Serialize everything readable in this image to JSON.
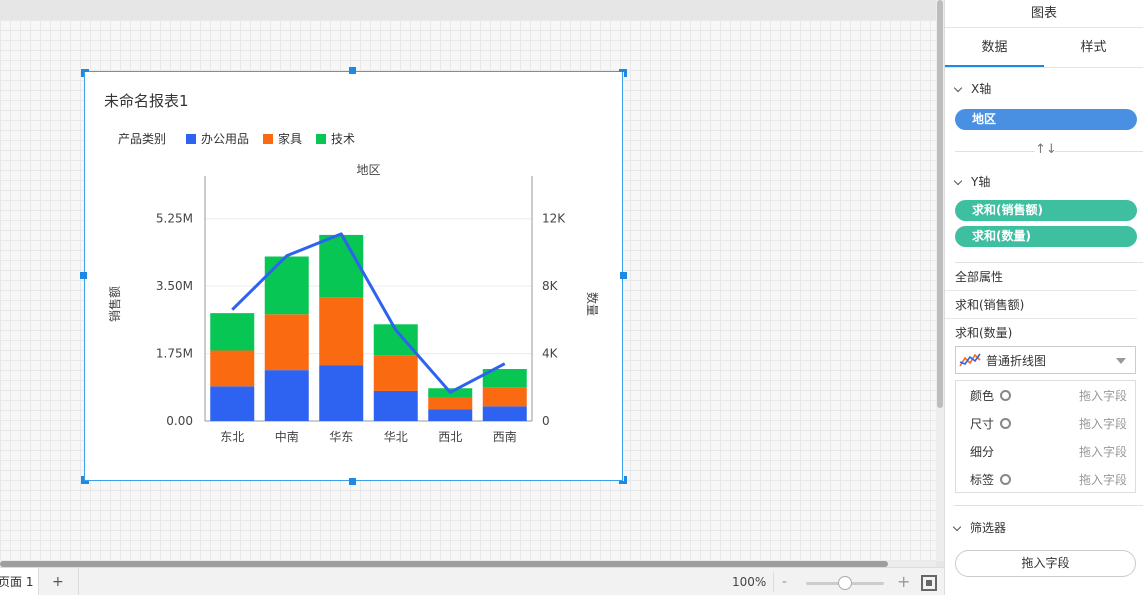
{
  "widget": {
    "title": "未命名报表1"
  },
  "legend": {
    "title": "产品类别",
    "items": [
      {
        "label": "办公用品",
        "color": "#2d63f0"
      },
      {
        "label": "家具",
        "color": "#fa6b11"
      },
      {
        "label": "技术",
        "color": "#08c654"
      }
    ]
  },
  "chart_data": {
    "type": "bar",
    "stacked": true,
    "title": "",
    "xlabel": "地区",
    "ylabel": "销售额",
    "y2label": "数量",
    "categories": [
      "东北",
      "中南",
      "华东",
      "华北",
      "西北",
      "西南"
    ],
    "series": [
      {
        "name": "办公用品",
        "type": "bar",
        "values": [
          0.9,
          1.32,
          1.45,
          0.78,
          0.3,
          0.38
        ]
      },
      {
        "name": "家具",
        "type": "bar",
        "values": [
          0.93,
          1.45,
          1.75,
          0.93,
          0.3,
          0.5
        ]
      },
      {
        "name": "技术",
        "type": "bar",
        "values": [
          0.97,
          1.5,
          1.63,
          0.8,
          0.25,
          0.47
        ]
      }
    ],
    "line": {
      "name": "数量",
      "type": "line",
      "axis": "right",
      "values": [
        6600,
        9800,
        11100,
        5400,
        1700,
        3400
      ],
      "color": "#2d63f0"
    },
    "yticks": [
      "0.00",
      "1.75M",
      "3.50M",
      "5.25M"
    ],
    "ytick_values": [
      0,
      1.75,
      3.5,
      5.25
    ],
    "y2ticks": [
      "0",
      "4K",
      "8K",
      "12K"
    ],
    "y2tick_values": [
      0,
      4000,
      8000,
      12000
    ],
    "ylim": [
      0,
      6.1
    ],
    "y2lim": [
      0,
      13940
    ],
    "grid": true,
    "legend_position": "top-left"
  },
  "panel": {
    "title": "图表",
    "tabs": [
      "数据",
      "样式"
    ],
    "x_axis_label": "X轴",
    "x_field": "地区",
    "swap_icon": "↑↓",
    "y_axis_label": "Y轴",
    "y_fields": [
      "求和(销售额)",
      "求和(数量)"
    ],
    "props": [
      "全部属性",
      "求和(销售额)",
      "求和(数量)"
    ],
    "chart_type": "普通折线图",
    "marks": [
      {
        "label": "颜色",
        "has_gear": true,
        "drop": "拖入字段"
      },
      {
        "label": "尺寸",
        "has_gear": true,
        "drop": "拖入字段"
      },
      {
        "label": "细分",
        "has_gear": false,
        "drop": "拖入字段"
      },
      {
        "label": "标签",
        "has_gear": true,
        "drop": "拖入字段"
      }
    ],
    "filter_label": "筛选器",
    "filter_button": "拖入字段"
  },
  "statusbar": {
    "page_tab": "页面 1",
    "add_page": "+",
    "zoom": "100%",
    "zoom_minus": "-",
    "zoom_plus": "+"
  }
}
